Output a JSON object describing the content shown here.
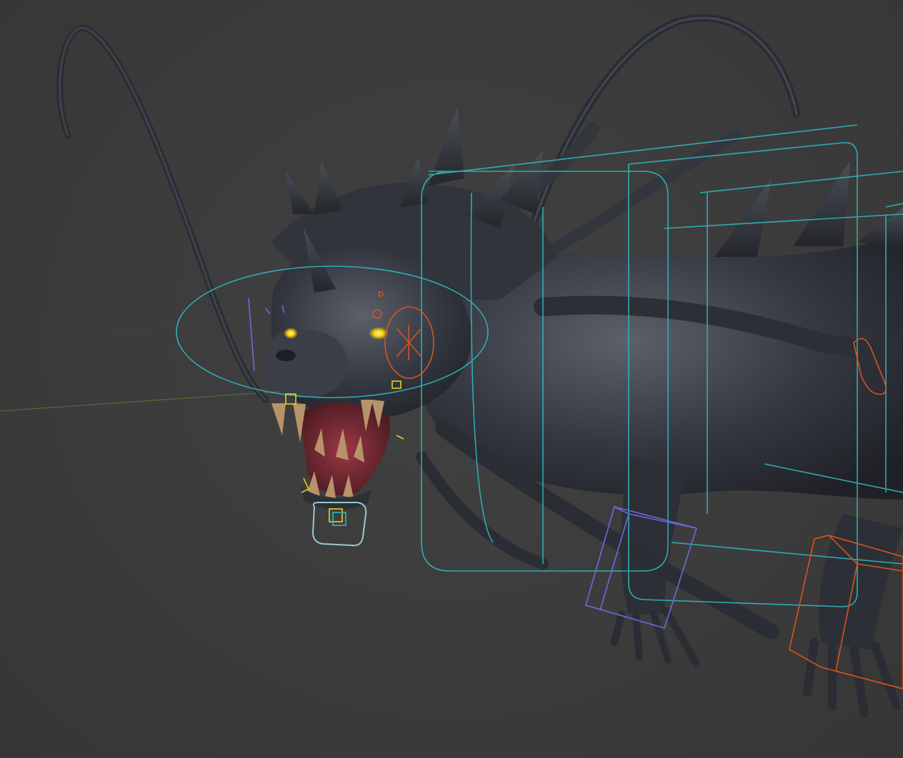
{
  "viewport": {
    "mode": "3D viewport",
    "background_color": "#3a3a3a"
  },
  "scene": {
    "object": "creature-model",
    "colors": {
      "body": "#2f3238",
      "body_highlight": "#5a5f68",
      "eye_glow": "#ffd400",
      "teeth": "#b8926a",
      "mouth": "#7a2a34",
      "rig_cyan": "#2fb8c0",
      "rig_orange": "#d8541e",
      "rig_purple": "#6a6ae0",
      "rig_yellow": "#e8d21a",
      "axis_green": "#6a8a3a",
      "axis_red": "#8a3a3a"
    }
  }
}
